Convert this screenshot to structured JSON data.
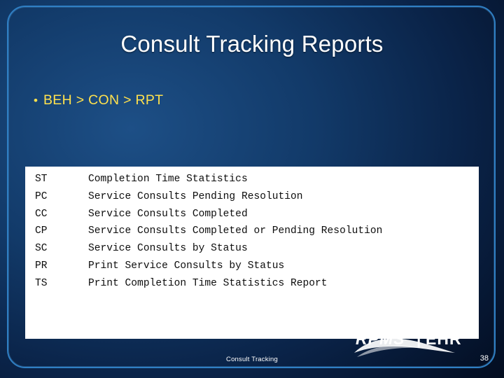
{
  "slide": {
    "title": "Consult Tracking Reports",
    "bullet": {
      "marker": "•",
      "text": "BEH > CON > RPT"
    },
    "menu_table": {
      "rows": [
        {
          "code": "ST",
          "description": "Completion Time Statistics"
        },
        {
          "code": "PC",
          "description": "Service Consults Pending Resolution"
        },
        {
          "code": "CC",
          "description": "Service Consults Completed"
        },
        {
          "code": "CP",
          "description": "Service Consults Completed or Pending Resolution"
        },
        {
          "code": "SC",
          "description": "Service Consults by Status"
        },
        {
          "code": "PR",
          "description": "Print Service Consults by Status"
        },
        {
          "code": "TS",
          "description": "Print Completion Time Statistics Report"
        }
      ]
    },
    "footer": {
      "center_text": "Consult Tracking",
      "page_number": "38"
    },
    "logo": {
      "primary_text": "RPMS",
      "secondary_text": "EHR",
      "divider": "|"
    },
    "colors": {
      "title_text": "#ffffff",
      "bullet_text": "#ffe14d",
      "panel_background": "#ffffff",
      "panel_text": "#0d0d0d",
      "border": "#2f7fc4",
      "logo_fill": "#ffffff"
    }
  }
}
